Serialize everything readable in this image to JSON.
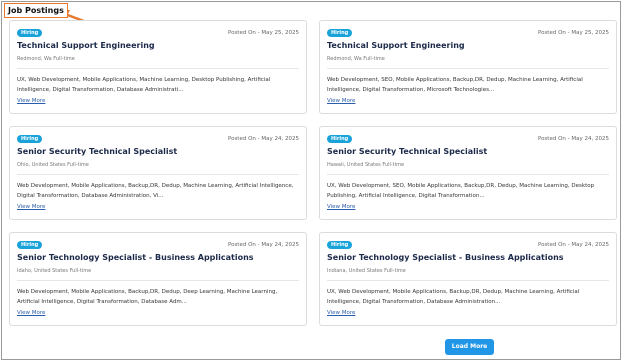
{
  "page": {
    "title": "Job Postings"
  },
  "jobs": [
    {
      "badge": "Hiring",
      "posted": "Posted On - May 25, 2025",
      "title": "Technical Support Engineering",
      "meta": "Redmond, Wa Full-time",
      "skills": "UX, Web Development, Mobile Applications, Machine Learning, Desktop Publishing, Artificial Intelligence, Digital Transformation, Database Administrati...",
      "view_more": "View More"
    },
    {
      "badge": "Hiring",
      "posted": "Posted On - May 25, 2025",
      "title": "Technical Support Engineering",
      "meta": "Redmond, Wa Full-time",
      "skills": "Web Development, SEO, Mobile Applications, Backup,DR, Dedup, Machine Learning, Artificial Intelligence, Digital Transformation, Microsoft Technologies...",
      "view_more": "View More"
    },
    {
      "badge": "Hiring",
      "posted": "Posted On - May 24, 2025",
      "title": "Senior Security Technical Specialist",
      "meta": "Ohio, United States Full-time",
      "skills": "Web Development, Mobile Applications, Backup,DR, Dedup, Machine Learning, Artificial Intelligence, Digital Transformation, Database Administration, Vi...",
      "view_more": "View More"
    },
    {
      "badge": "Hiring",
      "posted": "Posted On - May 24, 2025",
      "title": "Senior Security Technical Specialist",
      "meta": "Hawaii, United States Full-time",
      "skills": "UX, Web Development, SEO, Mobile Applications, Backup,DR, Dedup, Machine Learning, Desktop Publishing, Artificial Intelligence, Digital Transformation...",
      "view_more": "View More"
    },
    {
      "badge": "Hiring",
      "posted": "Posted On - May 24, 2025",
      "title": "Senior Technology Specialist - Business Applications",
      "meta": "Idaho, United States Full-time",
      "skills": "Web Development, Mobile Applications, Backup,DR, Dedup, Deep Learning, Machine Learning, Artificial Intelligence, Digital Transformation, Database Adm...",
      "view_more": "View More"
    },
    {
      "badge": "Hiring",
      "posted": "Posted On - May 24, 2025",
      "title": "Senior Technology Specialist - Business Applications",
      "meta": "Indiana, United States Full-time",
      "skills": "UX, Web Development, Mobile Applications, Backup,DR, Dedup, Machine Learning, Artificial Intelligence, Digital Transformation, Database Administration...",
      "view_more": "View More"
    }
  ],
  "load_more": "Load More",
  "colors": {
    "badge": "#1aa3d9",
    "annotation": "#e8792e",
    "button": "#2196e6",
    "link": "#2a5dab"
  }
}
